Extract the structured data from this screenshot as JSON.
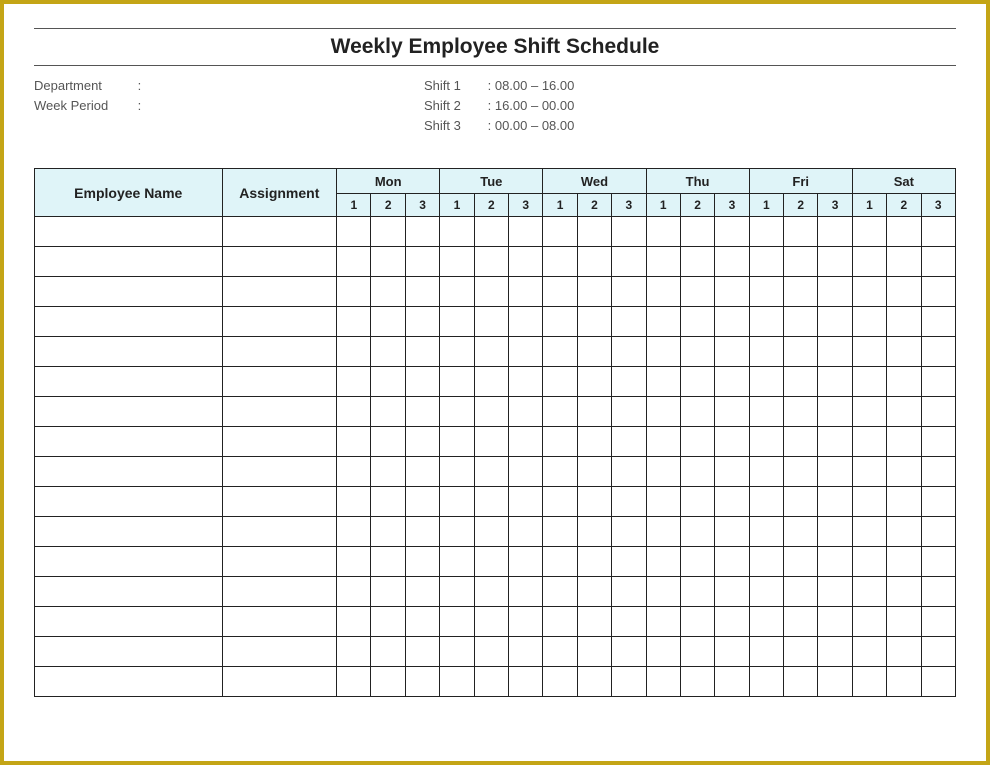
{
  "title": "Weekly Employee Shift Schedule",
  "info": {
    "department_label": "Department",
    "department_sep": ":",
    "week_period_label": "Week Period",
    "week_period_sep": ":",
    "shifts": [
      {
        "label": "Shift 1",
        "time": "08.00 – 16.00"
      },
      {
        "label": "Shift 2",
        "time": "16.00 – 00.00"
      },
      {
        "label": "Shift 3",
        "time": "00.00 – 08.00"
      }
    ]
  },
  "headers": {
    "employee_name": "Employee Name",
    "assignment": "Assignment",
    "days": [
      "Mon",
      "Tue",
      "Wed",
      "Thu",
      "Fri",
      "Sat"
    ],
    "shift_numbers": [
      "1",
      "2",
      "3"
    ]
  },
  "row_count": 16
}
